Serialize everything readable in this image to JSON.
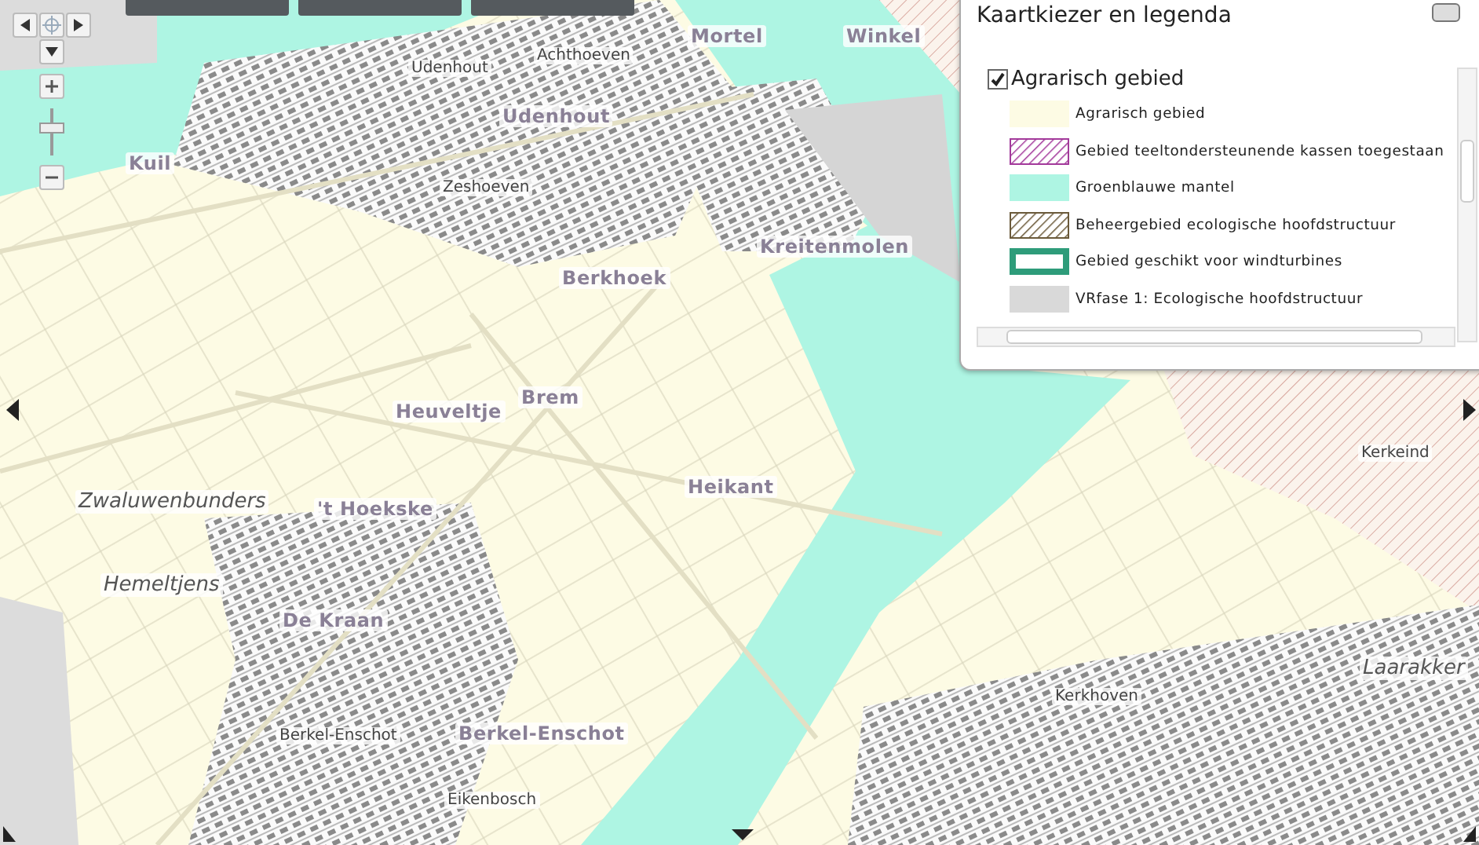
{
  "zoom": {
    "level": 0.6
  },
  "legend": {
    "title": "Kaartkiezer en legenda",
    "group": {
      "label": "Agrarisch gebied",
      "checked": true
    },
    "items": [
      {
        "label": "Agrarisch gebied",
        "kind": "fill",
        "color": "#fdfbe4"
      },
      {
        "label": "Gebied teeltondersteunende kassen toegestaan",
        "kind": "hatch",
        "color": "#a33a9b"
      },
      {
        "label": "Groenblauwe mantel",
        "kind": "fill",
        "color": "#aef5e3"
      },
      {
        "label": "Beheergebied ecologische hoofdstructuur",
        "kind": "hatch",
        "color": "#6b5a3a"
      },
      {
        "label": "Gebied geschikt voor windturbines",
        "kind": "outline",
        "color": "#2e9c7a"
      },
      {
        "label": "VRfase 1: Ecologische hoofdstructuur",
        "kind": "fill",
        "color": "#d9d9d9"
      }
    ]
  },
  "places": [
    {
      "text": "Mortel",
      "kind": "bold"
    },
    {
      "text": "Winkel",
      "kind": "bold"
    },
    {
      "text": "Achthoeven",
      "kind": "plain"
    },
    {
      "text": "Udenhout",
      "kind": "plain"
    },
    {
      "text": "Udenhout",
      "kind": "bold"
    },
    {
      "text": "Kuil",
      "kind": "bold"
    },
    {
      "text": "Zeshoeven",
      "kind": "plain"
    },
    {
      "text": "Kreitenmolen",
      "kind": "bold"
    },
    {
      "text": "Berkhoek",
      "kind": "bold"
    },
    {
      "text": "Brem",
      "kind": "bold"
    },
    {
      "text": "Heuveltje",
      "kind": "bold"
    },
    {
      "text": "Heikant",
      "kind": "bold"
    },
    {
      "text": "Zwaluwenbunders",
      "kind": "italic"
    },
    {
      "text": "'t Hoekske",
      "kind": "bold"
    },
    {
      "text": "Hemeltjens",
      "kind": "italic"
    },
    {
      "text": "De Kraan",
      "kind": "bold"
    },
    {
      "text": "Berkel-Enschot",
      "kind": "plain"
    },
    {
      "text": "Berkel-Enschot",
      "kind": "bold"
    },
    {
      "text": "Eikenbosch",
      "kind": "plain"
    },
    {
      "text": "Kerkhoven",
      "kind": "plain"
    },
    {
      "text": "Kerkeind",
      "kind": "plain"
    },
    {
      "text": "Laarakker",
      "kind": "italic"
    }
  ]
}
